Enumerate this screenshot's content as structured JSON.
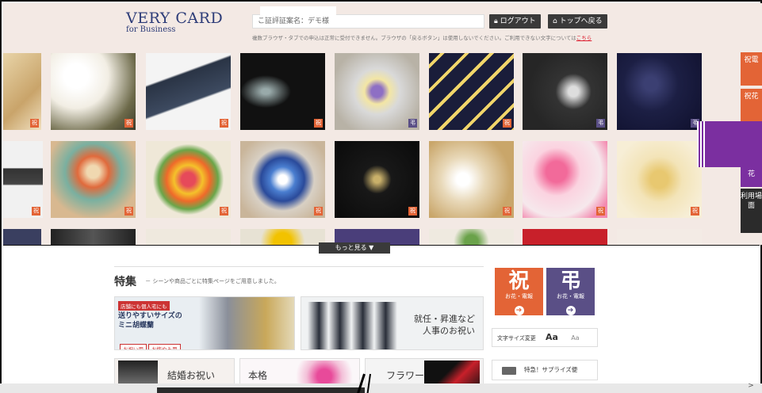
{
  "brand": {
    "name": "VERY CARD",
    "sub": "for Business"
  },
  "header": {
    "search_text": "こ証評証案名：デモ様",
    "logout_label": "ログアウト",
    "top_label": "トップへ戻る",
    "notice_text": "複数ブラウザ・タブでの申込は正常に受付できません。ブラウザの「戻るボタン」は使用しないでください。ご利用できない文字については",
    "notice_link": "こちら"
  },
  "badges": {
    "shuku": "祝",
    "cho": "弔"
  },
  "side_tabs": {
    "denpo": "祝電",
    "hana": "祝花",
    "hana2": "花",
    "scene": "利用場面"
  },
  "more_label": "もっと見る ▼",
  "feature": {
    "title": "特集",
    "desc": "－ シーンや商品ごとに特集ページをご用意しました。",
    "banner1_tag": "店舗にも個人宅にも",
    "banner1_line1": "送りやすいサイズの",
    "banner1_line2": "ミニ胡蝶蘭",
    "banner1_chip1": "お祝い用",
    "banner1_chip2": "お悔やみ用",
    "banner2_line1": "就任・昇進など",
    "banner2_line2": "人事のお祝い",
    "banner3": "結婚お祝い",
    "banner4": "本格",
    "banner5": "フラワー"
  },
  "right_panel": {
    "shuku_char": "祝",
    "shuku_sub": "お花・電報",
    "cho_char": "弔",
    "cho_sub": "お花・電報",
    "arrow": "➔",
    "font_label": "文字サイズ変更",
    "font_big": "Aa",
    "font_small": "Aa",
    "surprise_label": "特急！サプライズ便"
  },
  "colors": {
    "accent_orange": "#e36436",
    "accent_purple": "#5a4f86",
    "brand_navy": "#2d3c78"
  }
}
